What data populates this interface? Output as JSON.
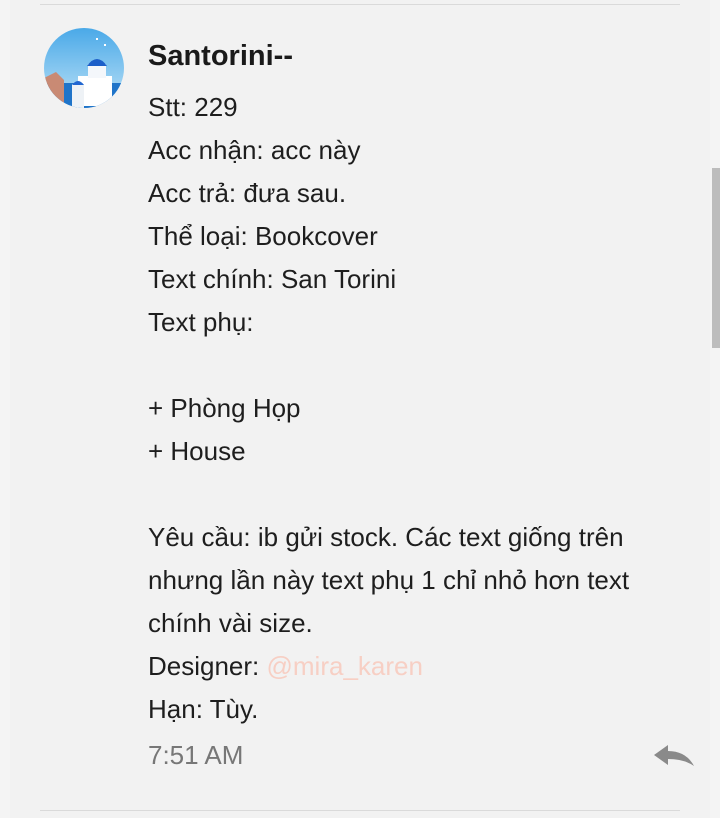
{
  "message": {
    "author": "Santorini--",
    "lines": {
      "stt": "Stt: 229",
      "acc_nhan": "Acc nhận: acc này",
      "acc_tra": "Acc trả: đưa sau.",
      "the_loai": "Thể loại: Bookcover",
      "text_chinh": "Text chính: San Torini",
      "text_phu": "Text phụ:",
      "item1": "+ Phòng Họp",
      "item2": "+ House",
      "yeu_cau": "Yêu cầu: ib gửi stock. Các text giống trên nhưng lần này text phụ 1 chỉ nhỏ hơn text chính vài size.",
      "designer_label": "Designer: ",
      "designer_mention": "@mira_karen",
      "han": "Hạn: Tùy."
    },
    "timestamp": "7:51 AM",
    "avatar_icon": "santorini-avatar-icon",
    "reply_icon": "reply-arrow-icon",
    "mention_color": "#f7cfc4"
  }
}
